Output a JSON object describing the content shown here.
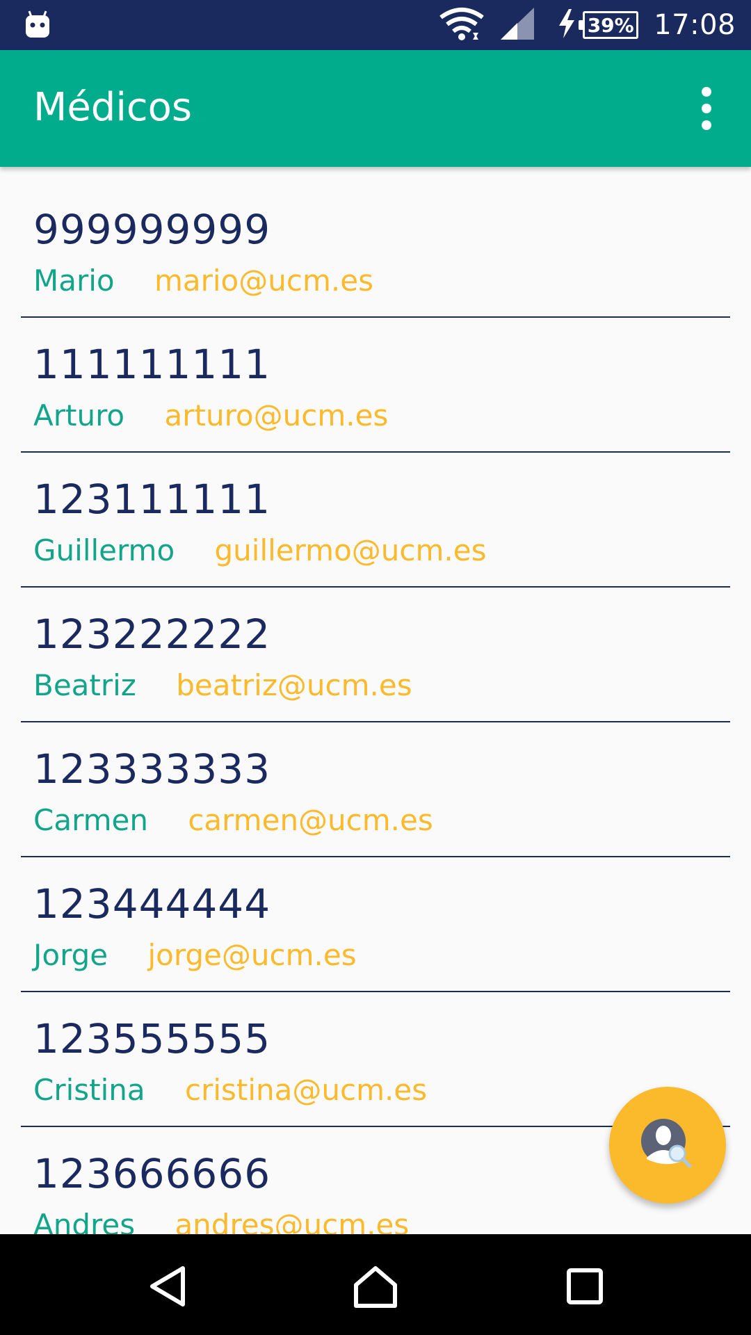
{
  "status_bar": {
    "battery": "39%",
    "time": "17:08",
    "icons": [
      "android-notification-icon",
      "wifi-icon",
      "signal-icon",
      "charging-icon",
      "battery-icon"
    ]
  },
  "app_bar": {
    "title": "Médicos",
    "menu_icon": "more-vert-icon"
  },
  "doctors": [
    {
      "phone": "999999999",
      "name": "Mario",
      "email": "mario@ucm.es"
    },
    {
      "phone": "111111111",
      "name": "Arturo",
      "email": "arturo@ucm.es"
    },
    {
      "phone": "123111111",
      "name": "Guillermo",
      "email": "guillermo@ucm.es"
    },
    {
      "phone": "123222222",
      "name": "Beatriz",
      "email": "beatriz@ucm.es"
    },
    {
      "phone": "123333333",
      "name": "Carmen",
      "email": "carmen@ucm.es"
    },
    {
      "phone": "123444444",
      "name": "Jorge",
      "email": "jorge@ucm.es"
    },
    {
      "phone": "123555555",
      "name": "Cristina",
      "email": "cristina@ucm.es"
    },
    {
      "phone": "123666666",
      "name": "Andres",
      "email": "andres@ucm.es"
    }
  ],
  "fab": {
    "icon": "search-user-icon"
  },
  "nav_bar": {
    "icons": [
      "back-icon",
      "home-icon",
      "recents-icon"
    ]
  },
  "colors": {
    "status_bar": "#1b2a5e",
    "app_bar": "#00ac8c",
    "phone_text": "#1b2a5e",
    "name_text": "#12a58a",
    "email_text": "#fbb92c",
    "fab": "#fbb92c",
    "divider": "#1b2a5e"
  }
}
